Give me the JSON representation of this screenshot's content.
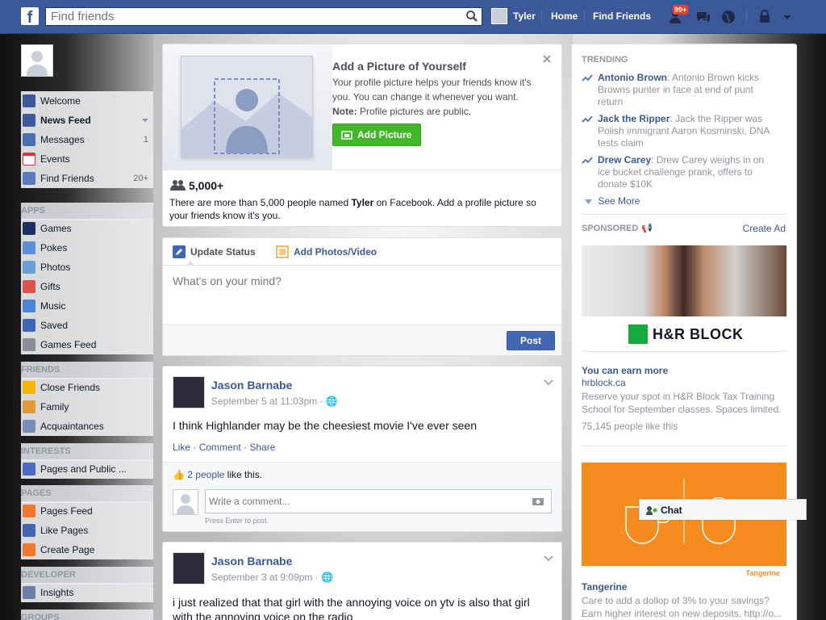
{
  "topbar": {
    "search_placeholder": "Find friends",
    "user_name": "Tyler",
    "home": "Home",
    "find_friends": "Find Friends",
    "notif_badge": "99+"
  },
  "left_nav": {
    "favorites": [
      {
        "label": "Welcome",
        "count": "",
        "icon_color": "#3b5998"
      },
      {
        "label": "News Feed",
        "count": "",
        "icon_color": "#3b5998"
      },
      {
        "label": "Messages",
        "count": "1",
        "icon_color": "#4c6fb0"
      },
      {
        "label": "Events",
        "count": "",
        "icon_color": "#d33"
      },
      {
        "label": "Find Friends",
        "count": "20+",
        "icon_color": "#5b7bbf"
      }
    ],
    "apps_title": "APPS",
    "apps": [
      {
        "label": "Games",
        "icon_color": "#1d2f63"
      },
      {
        "label": "Pokes",
        "icon_color": "#5b8fd6"
      },
      {
        "label": "Photos",
        "icon_color": "#6aa0d8"
      },
      {
        "label": "Gifts",
        "icon_color": "#d9534f"
      },
      {
        "label": "Music",
        "icon_color": "#4a86d3"
      },
      {
        "label": "Saved",
        "icon_color": "#4267b2"
      },
      {
        "label": "Games Feed",
        "icon_color": "#8b8f99"
      }
    ],
    "friends_title": "FRIENDS",
    "friends": [
      {
        "label": "Close Friends",
        "icon_color": "#f5b400"
      },
      {
        "label": "Family",
        "icon_color": "#e09a3c"
      },
      {
        "label": "Acquaintances",
        "icon_color": "#7a8fb8"
      }
    ],
    "interests_title": "INTERESTS",
    "interests": [
      {
        "label": "Pages and Public ...",
        "icon_color": "#4a6bbf"
      }
    ],
    "pages_title": "PAGES",
    "pages": [
      {
        "label": "Pages Feed",
        "icon_color": "#f07830"
      },
      {
        "label": "Like Pages",
        "icon_color": "#4267b2"
      },
      {
        "label": "Create Page",
        "icon_color": "#f07830"
      }
    ],
    "developer_title": "DEVELOPER",
    "developer": [
      {
        "label": "Insights",
        "icon_color": "#6c7fa8"
      }
    ],
    "groups_title": "GROUPS"
  },
  "profile_prompt": {
    "title": "Add a Picture of Yourself",
    "body": "Your profile picture helps your friends know it's you. You can change it whenever you want.",
    "note_label": "Note:",
    "note_text": " Profile pictures are public.",
    "button": "Add Picture",
    "count": "5,000+",
    "footer_pre": "There are more than 5,000 people named ",
    "footer_name": "Tyler",
    "footer_post": " on Facebook. Add a profile picture so your friends know it's you."
  },
  "composer": {
    "tab_status": "Update Status",
    "tab_photos": "Add Photos/Video",
    "placeholder": "What's on your mind?",
    "post_button": "Post"
  },
  "posts": [
    {
      "author": "Jason Barnabe",
      "time": "September 5 at 11:03pm",
      "sep": " · ",
      "text": "I think Highlander may be the cheesiest movie I've ever seen",
      "actions": [
        "Like",
        "Comment",
        "Share"
      ],
      "likes_link": "2 people",
      "likes_text": " like this.",
      "comment_placeholder": "Write a comment...",
      "press_enter": "Press Enter to post."
    },
    {
      "author": "Jason Barnabe",
      "time": "September 3 at 9:09pm",
      "sep": " · ",
      "text": "i just realized that that girl with the annoying voice on ytv is also that girl with the annoying voice on the radio"
    }
  ],
  "trending": {
    "title": "TRENDING",
    "items": [
      {
        "name": "Antonio Brown",
        "desc": ": Antonio Brown kicks Browns punter in face at end of punt return"
      },
      {
        "name": "Jack the Ripper",
        "desc": ": Jack the Ripper was Polish immigrant Aaron Kosminski, DNA tests claim"
      },
      {
        "name": "Drew Carey",
        "desc": ": Drew Carey weighs in on ice bucket challenge prank, offers to donate $10K"
      }
    ],
    "see_more": "See More"
  },
  "sponsored": {
    "title": "SPONSORED",
    "create_ad": "Create Ad",
    "ads": [
      {
        "brand": "H&R BLOCK",
        "headline": "You can earn more",
        "domain": "hrblock.ca",
        "body": "Reserve your spot in H&R Block Tax Training School for September classes. Spaces limited.",
        "likes": "75,145 people like this",
        "brand_color": "#14aa3c"
      },
      {
        "brand": "Tangerine",
        "headline": "Tangerine",
        "body": "Care to add a dollop of 3% to your savings? Earn higher interest on new deposits. http://o...",
        "bg_color": "#f68b1f"
      }
    ]
  },
  "chat": {
    "label": "Chat"
  },
  "colors": {
    "brand": "#3b5998",
    "link": "#3b5998",
    "green": "#42b72a"
  }
}
